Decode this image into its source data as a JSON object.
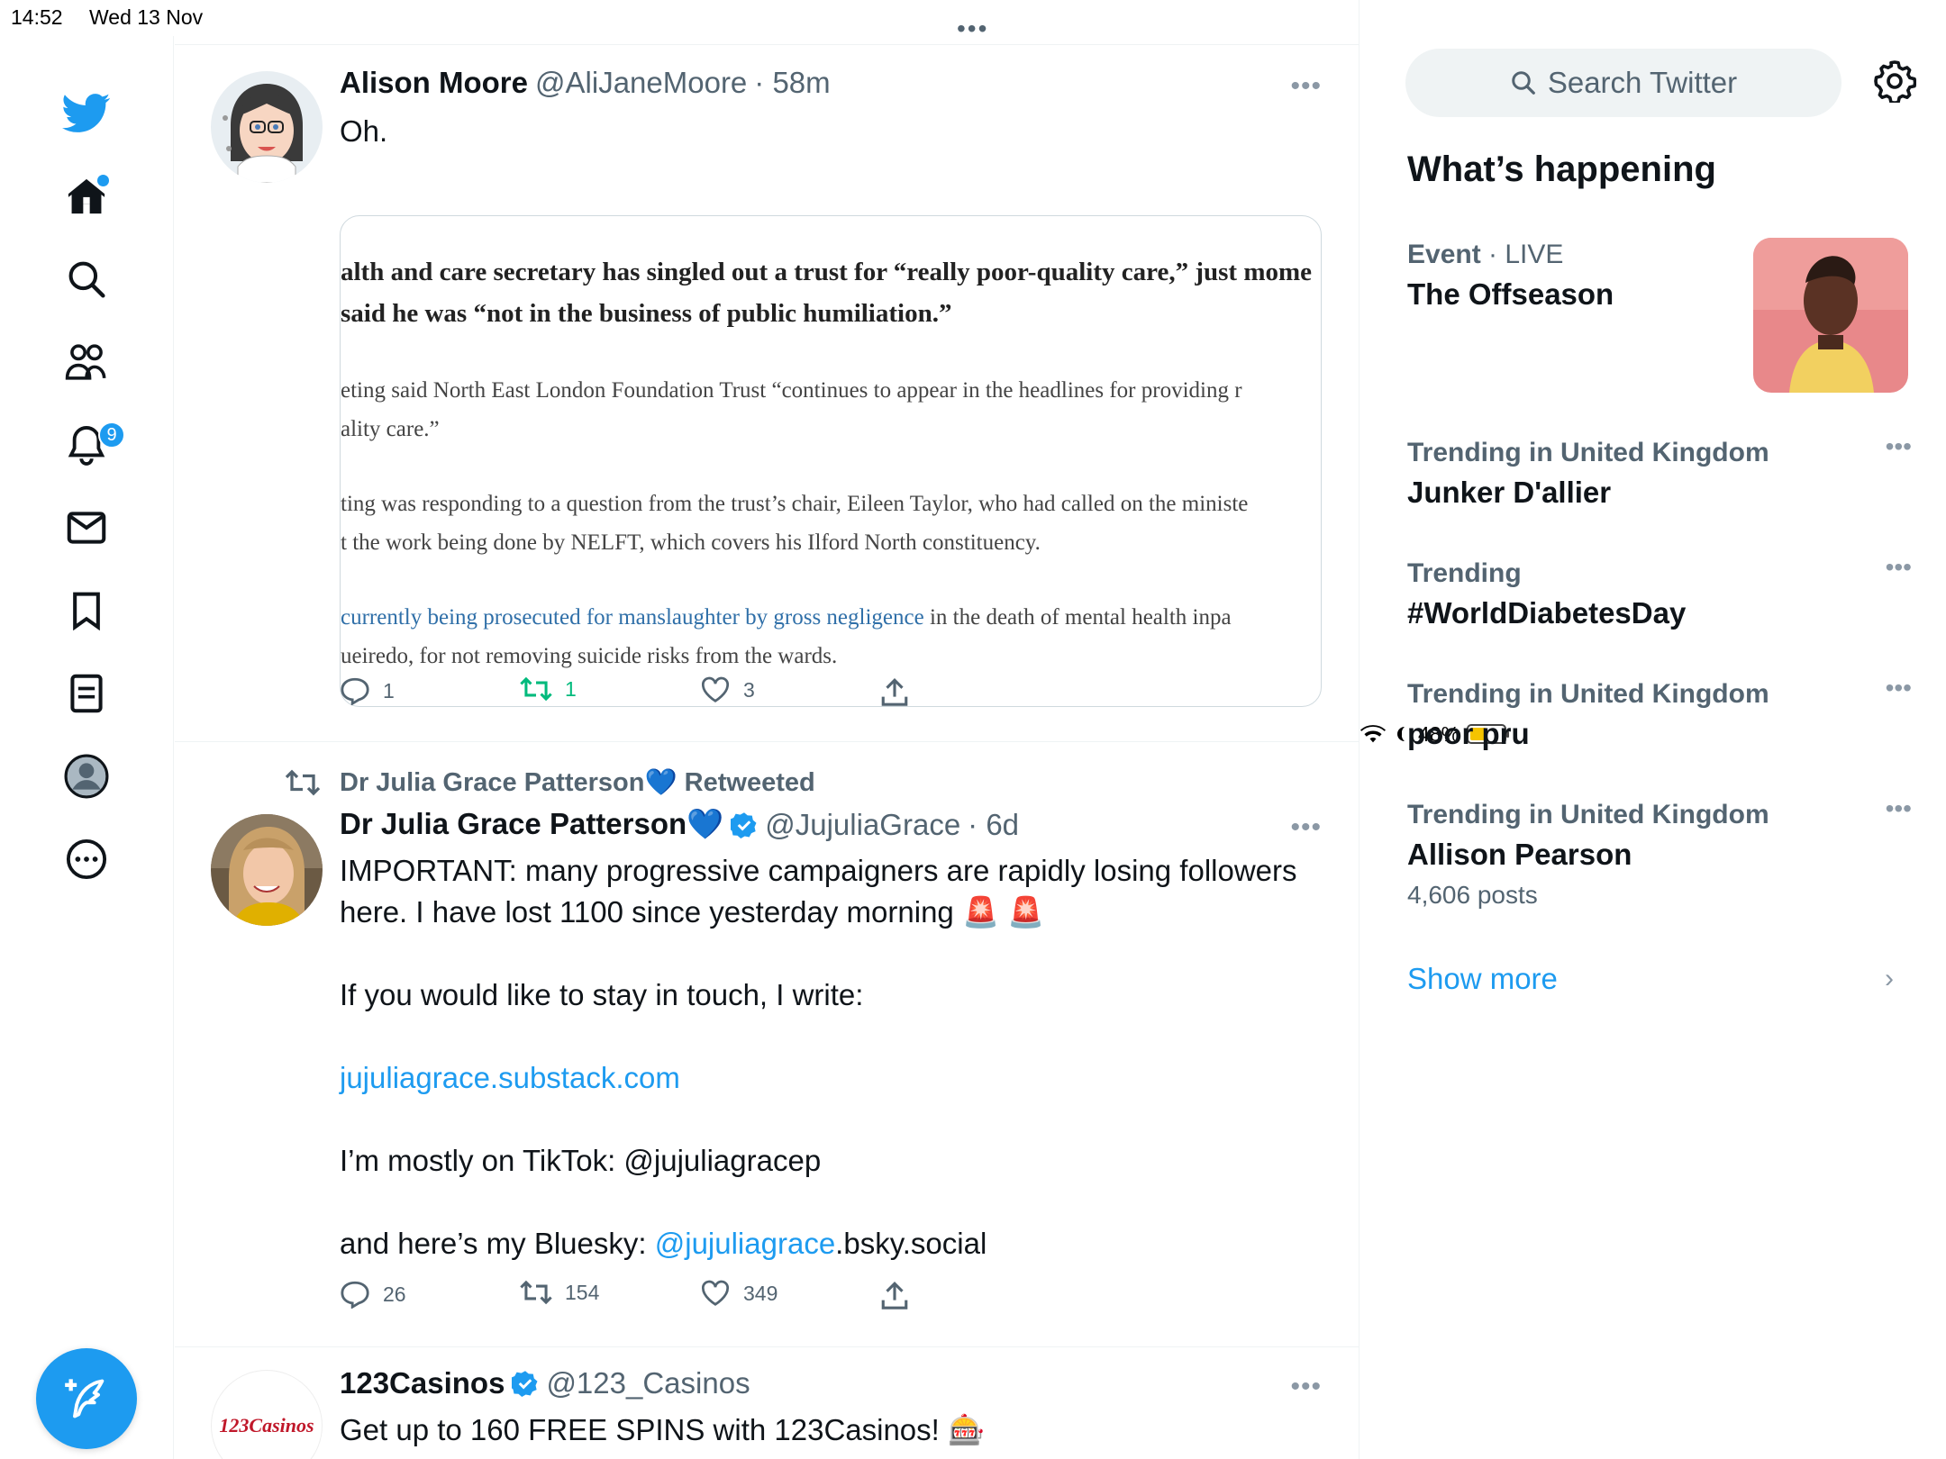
{
  "status_bar": {
    "time": "14:52",
    "date": "Wed 13 Nov",
    "battery": "48%"
  },
  "nav": {
    "notifications_badge": "9"
  },
  "feed": {
    "grabber": "•••",
    "tweets": [
      {
        "name": "Alison Moore",
        "handle": "@AliJaneMoore",
        "time": "· 58m",
        "text": "Oh.",
        "quote_image_text": {
          "line1": "alth and care secretary has singled out a trust for “really poor-quality care,” just mome",
          "line2": "said he was “not in the business of public humiliation.”",
          "line3": "eting said North East London Foundation Trust “continues to appear in the headlines for providing r",
          "line4": "ality care.”",
          "line5": "ting was responding to a question from the trust’s chair, Eileen Taylor, who had called on the ministe",
          "line6": "t the work being done by NELFT, which covers his Ilford North constituency.",
          "line7_link": "currently being prosecuted for manslaughter by gross negligence",
          "line7_rest": " in the death of mental health inpa",
          "line8": "ueiredo, for not removing suicide risks from the wards."
        },
        "replies": "1",
        "retweets": "1",
        "likes": "3"
      },
      {
        "retweeted_by": "Dr Julia Grace Patterson💙",
        "retweeted_label": "Retweeted",
        "name": "Dr Julia Grace Patterson💙",
        "handle": "@JujuliaGrace",
        "time": "· 6d",
        "text_line1": "IMPORTANT: many progressive campaigners are rapidly losing followers",
        "text_line2": "here. I have lost 1100 since yesterday morning 🚨 🚨",
        "text_line3": "If you would like to stay in touch, I write:",
        "text_link": "jujuliagrace.substack.com",
        "text_line4": "I’m mostly on TikTok: @jujuliagracep",
        "text_line5_pre": "and here’s my Bluesky: ",
        "text_line5_link": "@jujuliagrace",
        "text_line5_post": ".bsky.social",
        "replies": "26",
        "retweets": "154",
        "likes": "349"
      },
      {
        "name": "123Casinos",
        "handle": "@123_Casinos",
        "avatar_text": "123Casinos",
        "text": "Get up to 160 FREE SPINS with 123Casinos! 🎰"
      }
    ]
  },
  "sidebar": {
    "search_placeholder": "Search Twitter",
    "heading": "What’s happening",
    "event": {
      "category": "Event",
      "live": "LIVE",
      "title": "The Offseason"
    },
    "trends": [
      {
        "context": "Trending in United Kingdom",
        "title": "Junker D'allier"
      },
      {
        "context": "Trending",
        "title": "#WorldDiabetesDay"
      },
      {
        "context": "Trending in United Kingdom",
        "title": "poor pru"
      },
      {
        "context": "Trending in United Kingdom",
        "title": "Allison Pearson",
        "posts": "4,606 posts"
      }
    ],
    "show_more": "Show more"
  }
}
